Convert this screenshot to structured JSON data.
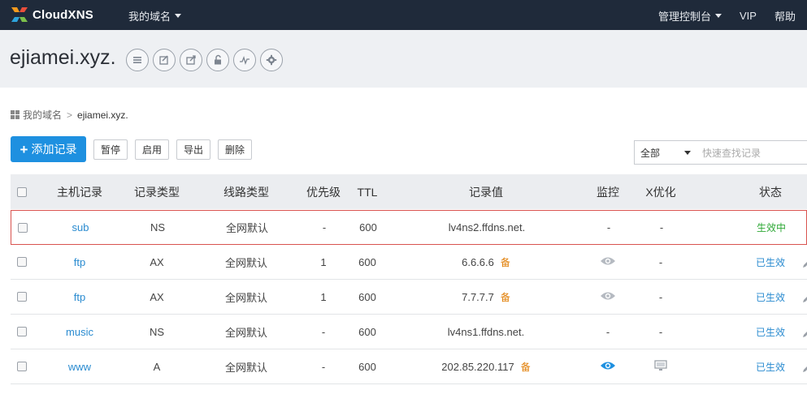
{
  "topbar": {
    "logo_text": "CloudXNS",
    "domains_menu": "我的域名",
    "console_menu": "管理控制台",
    "vip": "VIP",
    "help": "帮助"
  },
  "header": {
    "domain": "ejiamei.xyz."
  },
  "breadcrumb": {
    "root": "我的域名",
    "separator": ">",
    "current": "ejiamei.xyz."
  },
  "toolbar": {
    "add_label": "添加记录",
    "pause_label": "暂停",
    "enable_label": "启用",
    "export_label": "导出",
    "delete_label": "删除",
    "filter_value": "全部",
    "search_placeholder": "快速查找记录"
  },
  "table": {
    "headers": [
      "主机记录",
      "记录类型",
      "线路类型",
      "优先级",
      "TTL",
      "记录值",
      "监控",
      "X优化",
      "状态"
    ],
    "rows": [
      {
        "host": "sub",
        "type": "NS",
        "line": "全网默认",
        "priority": "-",
        "ttl": "600",
        "value": "lv4ns2.ffdns.net.",
        "backup": "",
        "monitor": "-",
        "xopt": "-",
        "status": "生效中"
      },
      {
        "host": "ftp",
        "type": "AX",
        "line": "全网默认",
        "priority": "1",
        "ttl": "600",
        "value": "6.6.6.6",
        "backup": "备",
        "monitor": "eye-gray",
        "xopt": "-",
        "status": "已生效"
      },
      {
        "host": "ftp",
        "type": "AX",
        "line": "全网默认",
        "priority": "1",
        "ttl": "600",
        "value": "7.7.7.7",
        "backup": "备",
        "monitor": "eye-gray",
        "xopt": "-",
        "status": "已生效"
      },
      {
        "host": "music",
        "type": "NS",
        "line": "全网默认",
        "priority": "-",
        "ttl": "600",
        "value": "lv4ns1.ffdns.net.",
        "backup": "",
        "monitor": "-",
        "xopt": "-",
        "status": "已生效"
      },
      {
        "host": "www",
        "type": "A",
        "line": "全网默认",
        "priority": "-",
        "ttl": "600",
        "value": "202.85.220.117",
        "backup": "备",
        "monitor": "eye-blue",
        "xopt": "monitor-icon",
        "status": "已生效"
      }
    ]
  },
  "colors": {
    "nav_bg": "#1f2a3a",
    "accent": "#1e90e0",
    "link": "#2a8bd0",
    "status_active": "#2ea836",
    "backup": "#e07b00",
    "highlight_border": "#d9534f"
  }
}
